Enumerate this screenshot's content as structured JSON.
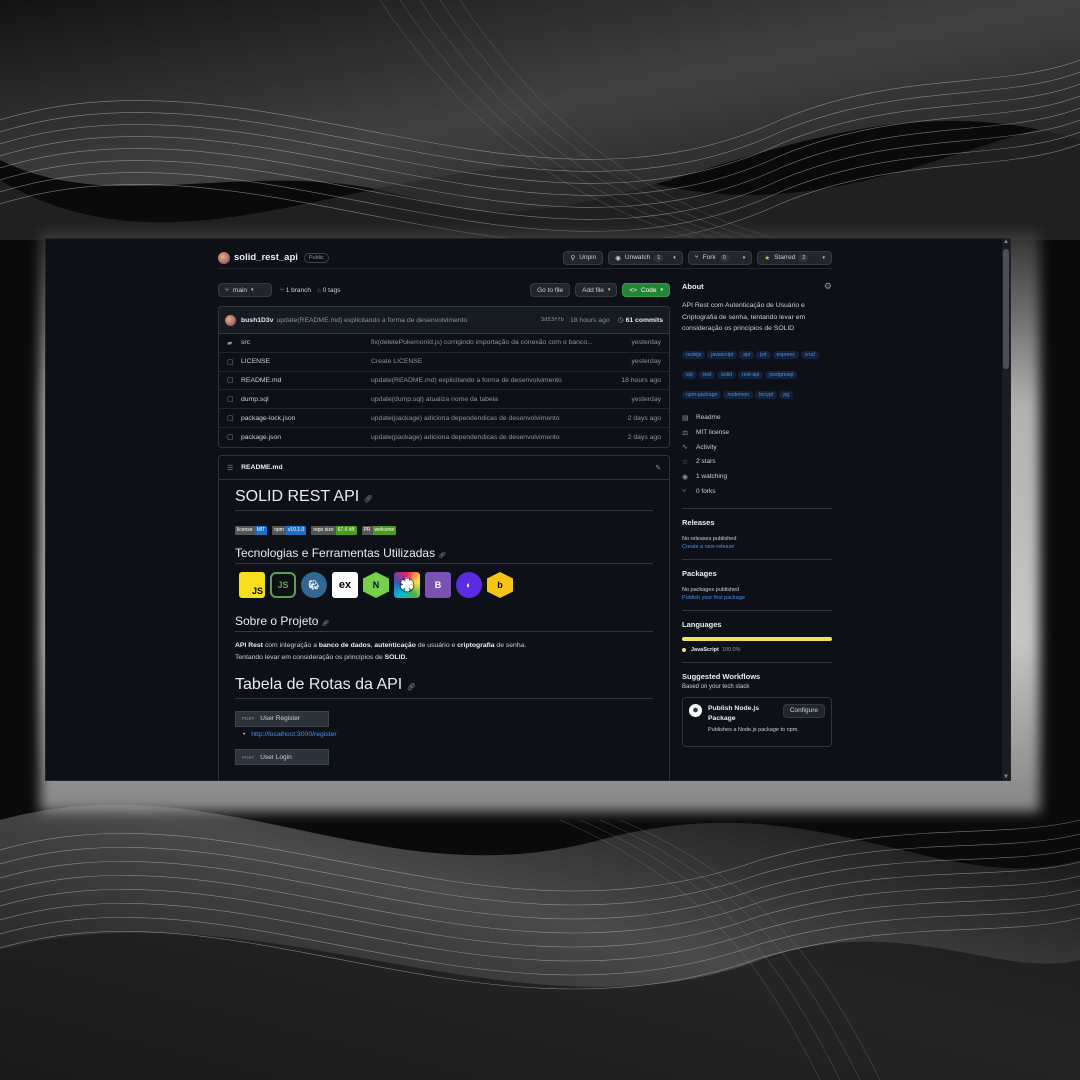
{
  "repo": {
    "name": "solid_rest_api",
    "visibility": "Public",
    "unpin_label": "Unpin",
    "unwatch_label": "Unwatch",
    "watch_count": "1",
    "fork_label": "Fork",
    "fork_count": "0",
    "starred_label": "Starred",
    "star_count": "2"
  },
  "toolbar": {
    "branch": "main",
    "branches": "1 branch",
    "tags": "0 tags",
    "go_to_file": "Go to file",
    "add_file": "Add file",
    "code": "Code"
  },
  "commit": {
    "author": "bush1D3v",
    "message": "update(README.md) explicitando a forma de desenvolvimento",
    "hash": "3d53ffb",
    "time": "18 hours ago",
    "count": "61 commits"
  },
  "files": [
    {
      "name": "src",
      "type": "folder",
      "message": "fix(deletePokemonId.js) corrigindo importação da conexão com o banco...",
      "time": "yesterday"
    },
    {
      "name": "LICENSE",
      "type": "file",
      "message": "Create LICENSE",
      "time": "yesterday"
    },
    {
      "name": "README.md",
      "type": "file",
      "message": "update(README.md) explicitando a forma de desenvolvimento",
      "time": "18 hours ago"
    },
    {
      "name": "dump.sql",
      "type": "file",
      "message": "update(dump.sql) atualiza nome da tabela",
      "time": "yesterday"
    },
    {
      "name": "package-lock.json",
      "type": "file",
      "message": "update(package) adiciona dependendicas de desenvolvimento",
      "time": "2 days ago"
    },
    {
      "name": "package.json",
      "type": "file",
      "message": "update(package) adiciona dependendicas de desenvolvimento",
      "time": "2 days ago"
    }
  ],
  "readme": {
    "file_label": "README.md",
    "title": "SOLID REST API",
    "badges": [
      {
        "label": "license",
        "value": "MIT",
        "color": "#1f6fc5"
      },
      {
        "label": "npm",
        "value": "v10.1.0",
        "color": "#1f6fc5"
      },
      {
        "label": "repo size",
        "value": "67.6 kB",
        "color": "#4c9a1c"
      },
      {
        "label": "PR",
        "value": "welcome",
        "color": "#4c9a1c"
      }
    ],
    "tech_heading": "Tecnologias e Ferramentas Utilizadas",
    "tech_icons": [
      "javascript-icon",
      "nodejs-icon",
      "postgresql-icon",
      "express-icon",
      "nodemon-icon",
      "jest-icon",
      "bootstrap-icon",
      "redux-icon",
      "bcrypt-icon"
    ],
    "project_heading": "Sobre o Projeto",
    "p1_b1": "API Rest",
    "p1_t1": " com integração a ",
    "p1_b2": "banco de dados",
    "p1_t2": ", ",
    "p1_b3": "autenticação",
    "p1_t3": " de usuário e ",
    "p1_b4": "criptografia",
    "p1_t4": " de senha.",
    "p2_t1": "Tentando levar em consideração os princípios de ",
    "p2_b1": "SOLID.",
    "routes_heading": "Tabela de Rotas da API",
    "routes": [
      {
        "method": "POST",
        "label": "User Register",
        "url": "http://localhost:3000/register"
      },
      {
        "method": "POST",
        "label": "User Login",
        "url": ""
      }
    ]
  },
  "about": {
    "title": "About",
    "description": "API Rest com Autenticação de Usuário e Criptografia de senha, tentando levar em consideração os princípios de SOLID",
    "topics": [
      "nodejs",
      "javascript",
      "api",
      "jwt",
      "express",
      "crud",
      "sql",
      "rest",
      "solid",
      "rest-api",
      "postgresql",
      "npm-package",
      "nodemon",
      "bcrypt",
      "pg"
    ],
    "links": [
      {
        "icon": "book-icon",
        "label": "Readme"
      },
      {
        "icon": "law-icon",
        "label": "MIT license"
      },
      {
        "icon": "pulse-icon",
        "label": "Activity"
      },
      {
        "icon": "star-icon",
        "label": "2 stars"
      },
      {
        "icon": "eye-icon",
        "label": "1 watching"
      },
      {
        "icon": "fork-icon",
        "label": "0 forks"
      }
    ]
  },
  "releases": {
    "title": "Releases",
    "none": "No releases published",
    "link": "Create a new release"
  },
  "packages": {
    "title": "Packages",
    "none": "No packages published",
    "link": "Publish your first package"
  },
  "languages": {
    "title": "Languages",
    "name": "JavaScript",
    "percent": "100.0%",
    "fraction": 1.0,
    "color": "#f1e05a"
  },
  "workflows": {
    "title": "Suggested Workflows",
    "subtitle": "Based on your tech stack",
    "card_title": "Publish Node.js Package",
    "card_button": "Configure",
    "card_desc": "Publishes a Node.js package to npm."
  }
}
